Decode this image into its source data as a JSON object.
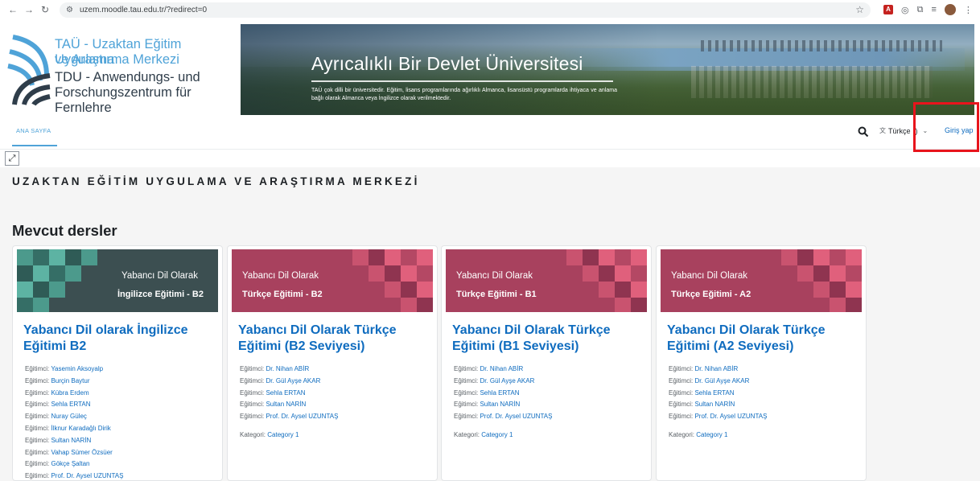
{
  "browser": {
    "url": "uzem.moodle.tau.edu.tr/?redirect=0"
  },
  "header": {
    "logo_lines": [
      "TAÜ - Uzaktan Eğitim Uygulama",
      "ve Araştırma Merkezi",
      "TDU - Anwendungs- und",
      "Forschungszentrum für Fernlehre"
    ],
    "hero_title": "Ayrıcalıklı Bir Devlet Üniversitesi",
    "hero_text": "TAÜ çok dilli bir üniversitedir. Eğitim, lisans programlarında ağırlıklı Almanca, lisansüstü programlarda ihtiyaca ve anlama bağlı olarak Almanca veya İngilizce olarak verilmektedir."
  },
  "navbar": {
    "home": "ANA SAYFA",
    "language": "Türkçe",
    "language_suffix": "r)",
    "login": "Giriş yap"
  },
  "main": {
    "site_heading": "UZAKTAN EĞİTİM UYGULAMA VE ARAŞTIRMA MERKEZİ",
    "section_title": "Mevcut dersler",
    "teacher_label": "Eğitimci:",
    "category_label": "Kategori:",
    "courses": [
      {
        "image_line1": "Yabancı Dil Olarak",
        "image_line2": "İngilizce Eğitimi - B2",
        "title": "Yabancı Dil olarak İngilizce Eğitimi B2",
        "teachers": [
          "Yasemin Aksoyalp",
          "Burçin Baytur",
          "Kübra Erdem",
          "Sehla ERTAN",
          "Nuray Güleç",
          "İlknur Karadağlı Dirik",
          "Sultan NARİN",
          "Vahap Sümer Özsüer",
          "Gökçe Şaltan",
          "Prof. Dr. Aysel UZUNTAŞ"
        ],
        "category": ""
      },
      {
        "image_line1": "Yabancı Dil Olarak",
        "image_line2": "Türkçe Eğitimi - B2",
        "title": "Yabancı Dil Olarak Türkçe Eğitimi (B2 Seviyesi)",
        "teachers": [
          "Dr. Nihan ABİR",
          "Dr. Gül Ayşe AKAR",
          "Sehla ERTAN",
          "Sultan NARİN",
          "Prof. Dr. Aysel UZUNTAŞ"
        ],
        "category": "Category 1"
      },
      {
        "image_line1": "Yabancı Dil Olarak",
        "image_line2": "Türkçe Eğitimi - B1",
        "title": "Yabancı Dil Olarak Türkçe Eğitimi (B1 Seviyesi)",
        "teachers": [
          "Dr. Nihan ABİR",
          "Dr. Gül Ayşe AKAR",
          "Sehla ERTAN",
          "Sultan NARİN",
          "Prof. Dr. Aysel UZUNTAŞ"
        ],
        "category": "Category 1"
      },
      {
        "image_line1": "Yabancı Dil Olarak",
        "image_line2": "Türkçe Eğitimi - A2",
        "title": "Yabancı Dil Olarak Türkçe Eğitimi (A2 Seviyesi)",
        "teachers": [
          "Dr. Nihan ABİR",
          "Dr. Gül Ayşe AKAR",
          "Sehla ERTAN",
          "Sultan NARİN",
          "Prof. Dr. Aysel UZUNTAŞ"
        ],
        "category": "Category 1"
      }
    ]
  },
  "colors": {
    "link": "#0f6cbf",
    "accent": "#4fa3d8",
    "highlight": "#e8141c",
    "card_teal": "#3c4f51",
    "card_rose": "#a8415e"
  }
}
